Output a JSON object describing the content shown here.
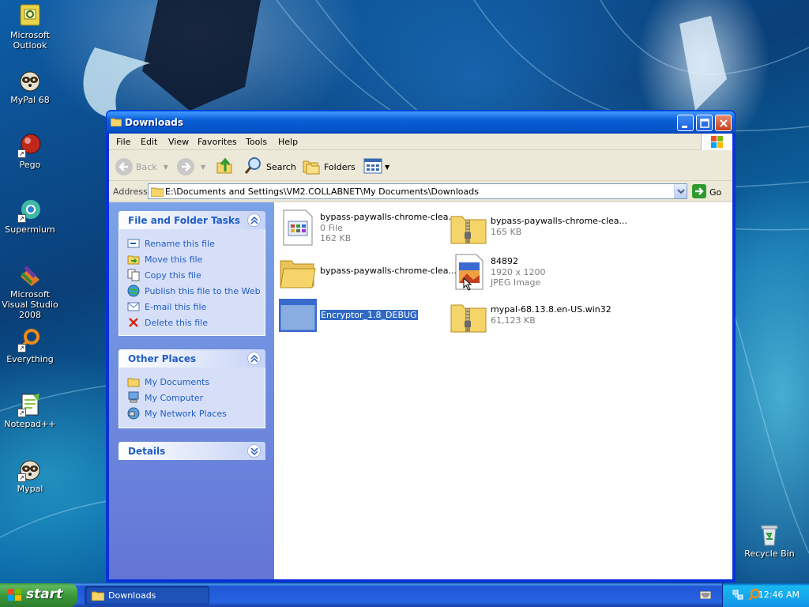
{
  "desktop": {
    "icons": [
      {
        "label": "Microsoft Outlook",
        "icon": "outlook-icon"
      },
      {
        "label": "MyPal 68",
        "icon": "mypal-icon"
      },
      {
        "label": "Pego",
        "icon": "pego-icon"
      },
      {
        "label": "Supermium",
        "icon": "supermium-icon"
      },
      {
        "label": "Microsoft Visual Studio 2008",
        "icon": "visual-studio-icon"
      },
      {
        "label": "Everything",
        "icon": "everything-icon"
      },
      {
        "label": "Notepad++",
        "icon": "notepadpp-icon"
      },
      {
        "label": "Mypal",
        "icon": "mypal-icon"
      },
      {
        "label": "Recycle Bin",
        "icon": "recycle-bin-icon"
      }
    ]
  },
  "window": {
    "title": "Downloads",
    "menu": [
      "File",
      "Edit",
      "View",
      "Favorites",
      "Tools",
      "Help"
    ],
    "toolbar": {
      "back": "Back",
      "search": "Search",
      "folders": "Folders"
    },
    "address": {
      "label": "Address",
      "value": "E:\\Documents and Settings\\VM2.COLLABNET\\My Documents\\Downloads",
      "go": "Go"
    },
    "task_pane": {
      "file_tasks": {
        "title": "File and Folder Tasks",
        "items": [
          {
            "label": "Rename this file",
            "icon": "rename-icon"
          },
          {
            "label": "Move this file",
            "icon": "move-icon"
          },
          {
            "label": "Copy this file",
            "icon": "copy-icon"
          },
          {
            "label": "Publish this file to the Web",
            "icon": "publish-web-icon"
          },
          {
            "label": "E-mail this file",
            "icon": "email-icon"
          },
          {
            "label": "Delete this file",
            "icon": "delete-icon"
          }
        ]
      },
      "other_places": {
        "title": "Other Places",
        "items": [
          {
            "label": "My Documents",
            "icon": "my-documents-icon"
          },
          {
            "label": "My Computer",
            "icon": "my-computer-icon"
          },
          {
            "label": "My Network Places",
            "icon": "network-places-icon"
          }
        ]
      },
      "details": {
        "title": "Details"
      }
    },
    "files": [
      {
        "name": "bypass-paywalls-chrome-clea...",
        "line2": "0 File",
        "line3": "162 KB",
        "icon": "generic-file-icon"
      },
      {
        "name": "bypass-paywalls-chrome-clea...",
        "line2": "165 KB",
        "line3": "",
        "icon": "zip-folder-icon"
      },
      {
        "name": "bypass-paywalls-chrome-clea...",
        "line2": "",
        "line3": "",
        "icon": "folder-icon"
      },
      {
        "name": "84892",
        "line2": "1920 x 1200",
        "line3": "JPEG Image",
        "icon": "jpeg-image-icon"
      },
      {
        "name": "Encryptor_1.8_DEBUG",
        "line2": "",
        "line3": "",
        "icon": "application-icon",
        "selected": true
      },
      {
        "name": "mypal-68.13.8.en-US.win32",
        "line2": "61,123 KB",
        "line3": "",
        "icon": "zip-folder-icon"
      }
    ]
  },
  "taskbar": {
    "start_label": "start",
    "task_label": "Downloads",
    "clock": "12:46 AM"
  },
  "colors": {
    "titlebar": "#0a5fd6",
    "taskpane": "#6375d6",
    "link": "#215dc6",
    "selection": "#316ac5",
    "start_green": "#3c9a3c"
  }
}
